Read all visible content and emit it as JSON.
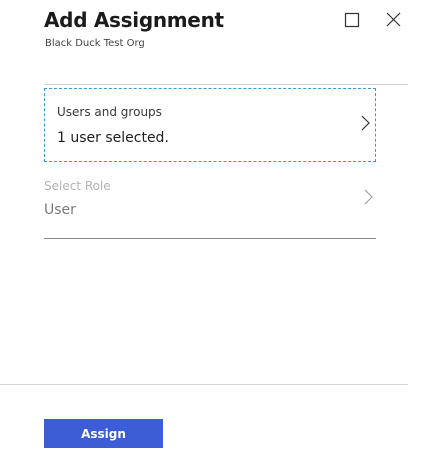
{
  "header": {
    "title": "Add Assignment",
    "subtitle": "Black Duck Test Org",
    "maximize_icon": "maximize-icon",
    "close_icon": "close-icon"
  },
  "fields": {
    "users": {
      "label": "Users and groups",
      "value": "1 user selected.",
      "icon": "chevron-right-icon"
    },
    "role": {
      "label": "Select Role",
      "value": "User",
      "icon": "chevron-right-icon"
    }
  },
  "footer": {
    "assign_label": "Assign"
  },
  "colors": {
    "accent": "#3c5dd6",
    "focus_border": "#3a9ad9"
  }
}
